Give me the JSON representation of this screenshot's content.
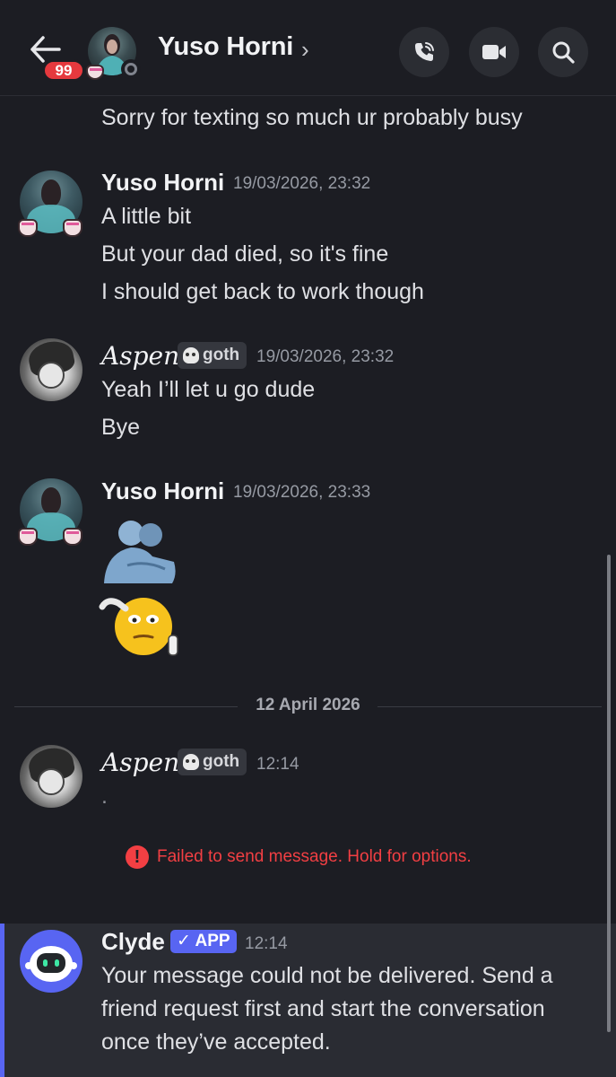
{
  "header": {
    "contact_name": "Yuso Horni",
    "unread_badge": "99",
    "status": "offline",
    "icons": [
      "back-arrow-icon",
      "phone-call-icon",
      "video-camera-icon",
      "search-icon"
    ]
  },
  "messages": {
    "first_line": "Sorry for texting so much ur probably busy",
    "group1": {
      "author": "Yuso Horni",
      "timestamp": "19/03/2026, 23:32",
      "lines": [
        "A little bit",
        "But your dad died, so it's fine",
        "I should get back to work though"
      ]
    },
    "group2": {
      "author": "Aspen",
      "tag": "goth",
      "timestamp": "19/03/2026, 23:32",
      "lines": [
        "Yeah I’ll let u go dude",
        "Bye"
      ]
    },
    "group3": {
      "author": "Yuso Horni",
      "timestamp": "19/03/2026, 23:33",
      "emojis": [
        "hug-emoji",
        "salute-emoji"
      ]
    },
    "date_divider": "12 April 2026",
    "group4": {
      "author": "Aspen",
      "tag": "goth",
      "timestamp": "12:14",
      "lines": [
        "."
      ]
    },
    "failed_notice": "Failed to send message. Hold for options.",
    "clyde": {
      "author": "Clyde",
      "app_badge": "✓ APP",
      "timestamp": "12:14",
      "lines": [
        "Your message could not be delivered. Send a",
        "friend request first and start the conversation",
        "once they’ve accepted."
      ]
    }
  },
  "colors": {
    "background": "#1c1d23",
    "accent": "#5865f2",
    "error": "#f23f43",
    "badge": "#e5393e"
  }
}
